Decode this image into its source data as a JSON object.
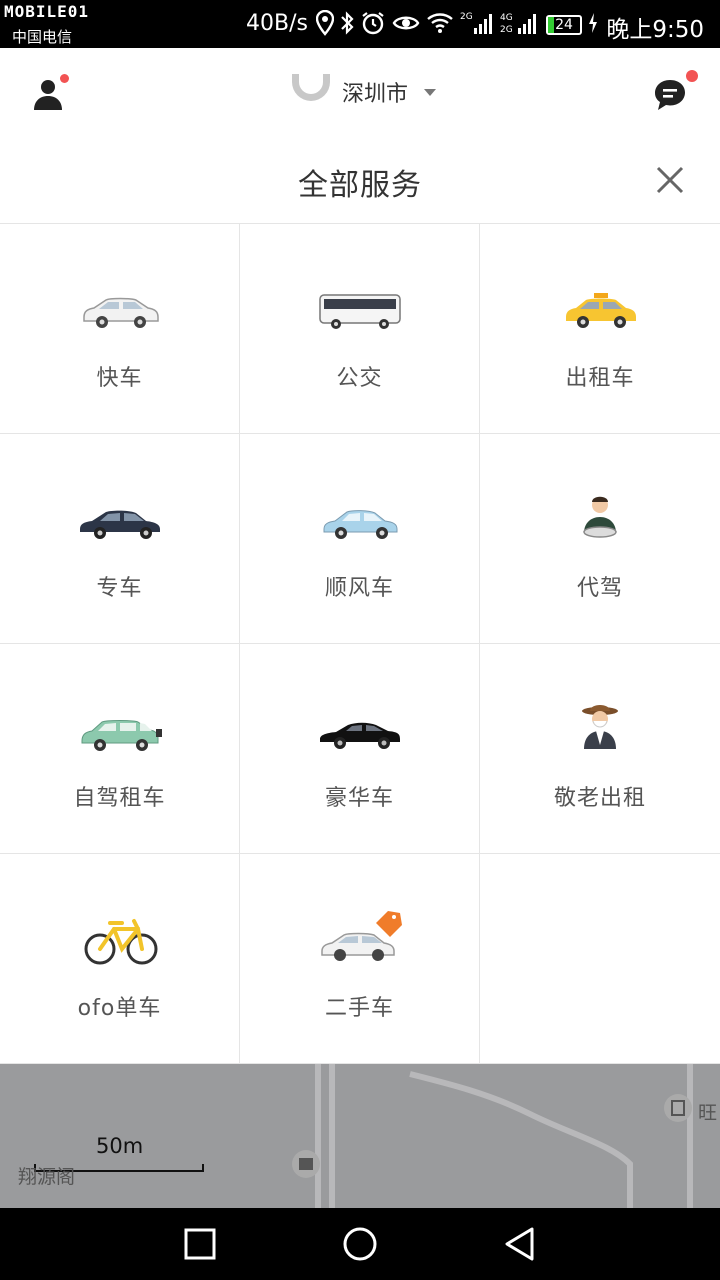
{
  "status_bar": {
    "brand": "MOBILE01",
    "carrier": "中国电信",
    "speed": "40B/s",
    "net_top": "4G",
    "net_bottom": "2G",
    "net_top2": "2G",
    "battery": "24",
    "time": "晚上9:50"
  },
  "header": {
    "city": "深圳市",
    "user_icon": "user-icon",
    "message_icon": "message-icon",
    "logo_icon": "didi-logo-icon",
    "badge_color": "#f25353"
  },
  "panel": {
    "title": "全部服务",
    "close_icon": "close-icon"
  },
  "services": [
    {
      "label": "快车",
      "icon": "express-car-icon"
    },
    {
      "label": "公交",
      "icon": "bus-icon"
    },
    {
      "label": "出租车",
      "icon": "taxi-icon"
    },
    {
      "label": "专车",
      "icon": "premier-car-icon"
    },
    {
      "label": "顺风车",
      "icon": "hitch-car-icon"
    },
    {
      "label": "代驾",
      "icon": "chauffeur-icon"
    },
    {
      "label": "自驾租车",
      "icon": "rental-car-icon"
    },
    {
      "label": "豪华车",
      "icon": "luxury-car-icon"
    },
    {
      "label": "敬老出租",
      "icon": "elderly-taxi-icon"
    },
    {
      "label": "ofo单车",
      "icon": "bike-icon"
    },
    {
      "label": "二手车",
      "icon": "used-car-icon"
    }
  ],
  "map": {
    "scale": "50m",
    "place_left": "翔源阁",
    "place_right": "旺"
  },
  "nav": {
    "recent_icon": "square-icon",
    "home_icon": "circle-icon",
    "back_icon": "triangle-back-icon"
  }
}
